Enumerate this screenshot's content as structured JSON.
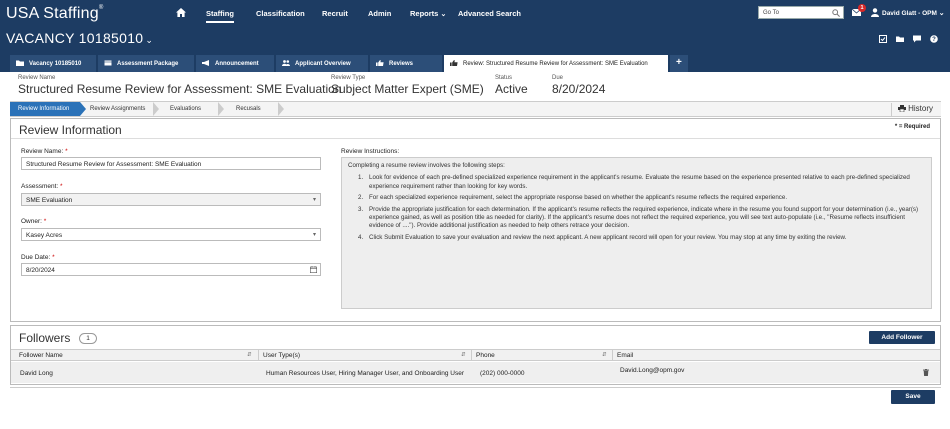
{
  "app": {
    "brand": "USA Staffing",
    "brand_mark": "®",
    "nav": [
      "Staffing",
      "Classification",
      "Recruit",
      "Admin",
      "Reports",
      "Advanced Search"
    ],
    "active_nav": "Staffing",
    "goto_placeholder": "Go To",
    "mail_count": "1",
    "user": "David Glatt - OPM"
  },
  "vacancy": {
    "title": "VACANCY 10185010",
    "tabs": [
      {
        "label": "Vacancy 10185010",
        "icon": "folder-icon"
      },
      {
        "label": "Assessment Package",
        "icon": "package-icon"
      },
      {
        "label": "Announcement",
        "icon": "megaphone-icon"
      },
      {
        "label": "Applicant Overview",
        "icon": "users-icon"
      },
      {
        "label": "Reviews",
        "icon": "thumb-icon"
      },
      {
        "label": "Review: Structured Resume Review for Assessment: SME Evaluation",
        "icon": "thumb-icon"
      }
    ],
    "add_tab": "+"
  },
  "review_header": {
    "name_label": "Review Name",
    "name": "Structured Resume Review for Assessment: SME Evaluation",
    "type_label": "Review Type",
    "type": "Subject Matter Expert (SME)",
    "status_label": "Status",
    "status": "Active",
    "due_label": "Due",
    "due": "8/20/2024"
  },
  "steps": [
    "Review Information",
    "Review Assignments",
    "Evaluations",
    "Recusals"
  ],
  "history_label": "History",
  "review_info": {
    "title": "Review Information",
    "required_note": "* = Required",
    "name_label": "Review Name:",
    "name_value": "Structured Resume Review for Assessment: SME Evaluation",
    "assessment_label": "Assessment:",
    "assessment_value": "SME Evaluation",
    "owner_label": "Owner:",
    "owner_value": "Kasey Acres",
    "due_label": "Due Date:",
    "due_value": "8/20/2024",
    "required_mark": "*",
    "instructions_label": "Review Instructions:",
    "instructions_intro": "Completing a resume review involves the following steps:",
    "instructions": [
      {
        "num": "1.",
        "text": "Look for evidence of each pre-defined specialized experience requirement in the applicant's resume. Evaluate the resume based on the experience presented relative to each pre-defined specialized experience requirement rather than looking for key words."
      },
      {
        "num": "2.",
        "text": "For each specialized experience requirement, select the appropriate response based on whether the applicant's resume reflects the required experience."
      },
      {
        "num": "3.",
        "text": "Provide the appropriate justification for each determination. If the applicant's resume reflects the required experience, indicate where in the resume you found support for your determination (i.e., year(s) experience gained, as well as position title as needed for clarity). If the applicant's resume does not reflect the required experience, you will see text auto-populate (i.e., \"Resume reflects insufficient evidence of ....\"). Provide additional justification as needed to help others retrace your decision."
      },
      {
        "num": "4.",
        "text": "Click Submit Evaluation to save your evaluation and review the next applicant. A new applicant record will open for your review. You may stop at any time by exiting the review."
      }
    ]
  },
  "followers": {
    "title": "Followers",
    "count": "1",
    "add_label": "Add Follower",
    "columns": [
      "Follower Name",
      "User Type(s)",
      "Phone",
      "Email"
    ],
    "rows": [
      {
        "name": "David Long",
        "types": "Human Resources User, Hiring Manager User, and Onboarding User",
        "phone": "(202) 000-0000",
        "email": "David.Long@opm.gov"
      }
    ]
  },
  "save_label": "Save",
  "colors": {
    "navy": "#1d3c63",
    "tab": "#2c4e78",
    "step_active": "#2b72b8",
    "badge": "#d62828"
  }
}
